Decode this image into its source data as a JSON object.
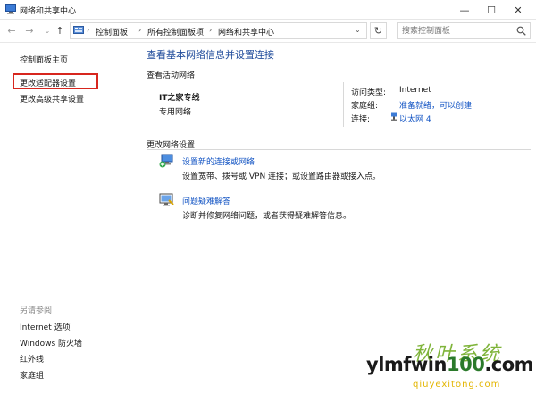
{
  "window": {
    "title": "网络和共享中心",
    "buttons": {
      "minimize": "—",
      "maximize": "☐",
      "close": "✕"
    }
  },
  "address_bar": {
    "nav": {
      "back": "←",
      "forward": "→",
      "recent": "⌄",
      "up": "↑"
    },
    "breadcrumbs": [
      "控制面板",
      "所有控制面板项",
      "网络和共享中心"
    ],
    "separator": "›",
    "dropdown": "⌄",
    "refresh": "↻",
    "search_placeholder": "搜索控制面板"
  },
  "sidebar": {
    "links": [
      "控制面板主页",
      "更改适配器设置",
      "更改高级共享设置"
    ],
    "see_also_label": "另请参阅",
    "see_also": [
      "Internet 选项",
      "Windows 防火墙",
      "红外线",
      "家庭组"
    ]
  },
  "main": {
    "title": "查看基本网络信息并设置连接",
    "active_section": "查看活动网络",
    "network": {
      "name": "IT之家专线",
      "category": "专用网络",
      "access_type_label": "访问类型:",
      "access_type": "Internet",
      "homegroup_label": "家庭组:",
      "homegroup": "准备就绪，可以创建",
      "connections_label": "连接:",
      "connection": "以太网 4"
    },
    "change_section": "更改网络设置",
    "tasks": [
      {
        "title": "设置新的连接或网络",
        "desc": "设置宽带、拨号或 VPN 连接；或设置路由器或接入点。"
      },
      {
        "title": "问题疑难解答",
        "desc": "诊断并修复网络问题，或者获得疑难解答信息。"
      }
    ]
  },
  "watermark": {
    "brand": "秋叶系统",
    "url_main": "ylmfwin",
    "url_accent": "100",
    "url_tail": ".com",
    "sub": "qiuyexitong.com"
  },
  "colors": {
    "link": "#1556c4",
    "title": "#1e4a9a",
    "highlight": "#d7261e"
  }
}
